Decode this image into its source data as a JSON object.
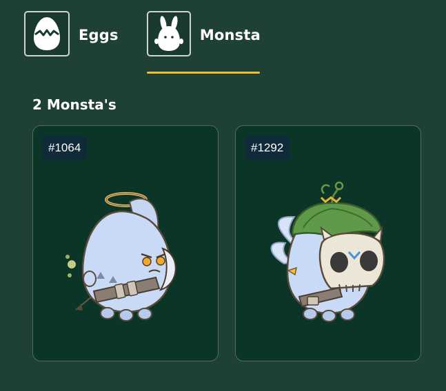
{
  "tabs": [
    {
      "label": "Eggs",
      "icon": "egg-icon",
      "active": false
    },
    {
      "label": "Monsta",
      "icon": "bunny-icon",
      "active": true
    }
  ],
  "accent_color": "#f1bc3a",
  "section": {
    "count_label": "2 Monsta's"
  },
  "cards": [
    {
      "id": "#1064",
      "art": "angel-monsta-illustration"
    },
    {
      "id": "#1292",
      "art": "skull-mask-monsta-illustration"
    }
  ]
}
